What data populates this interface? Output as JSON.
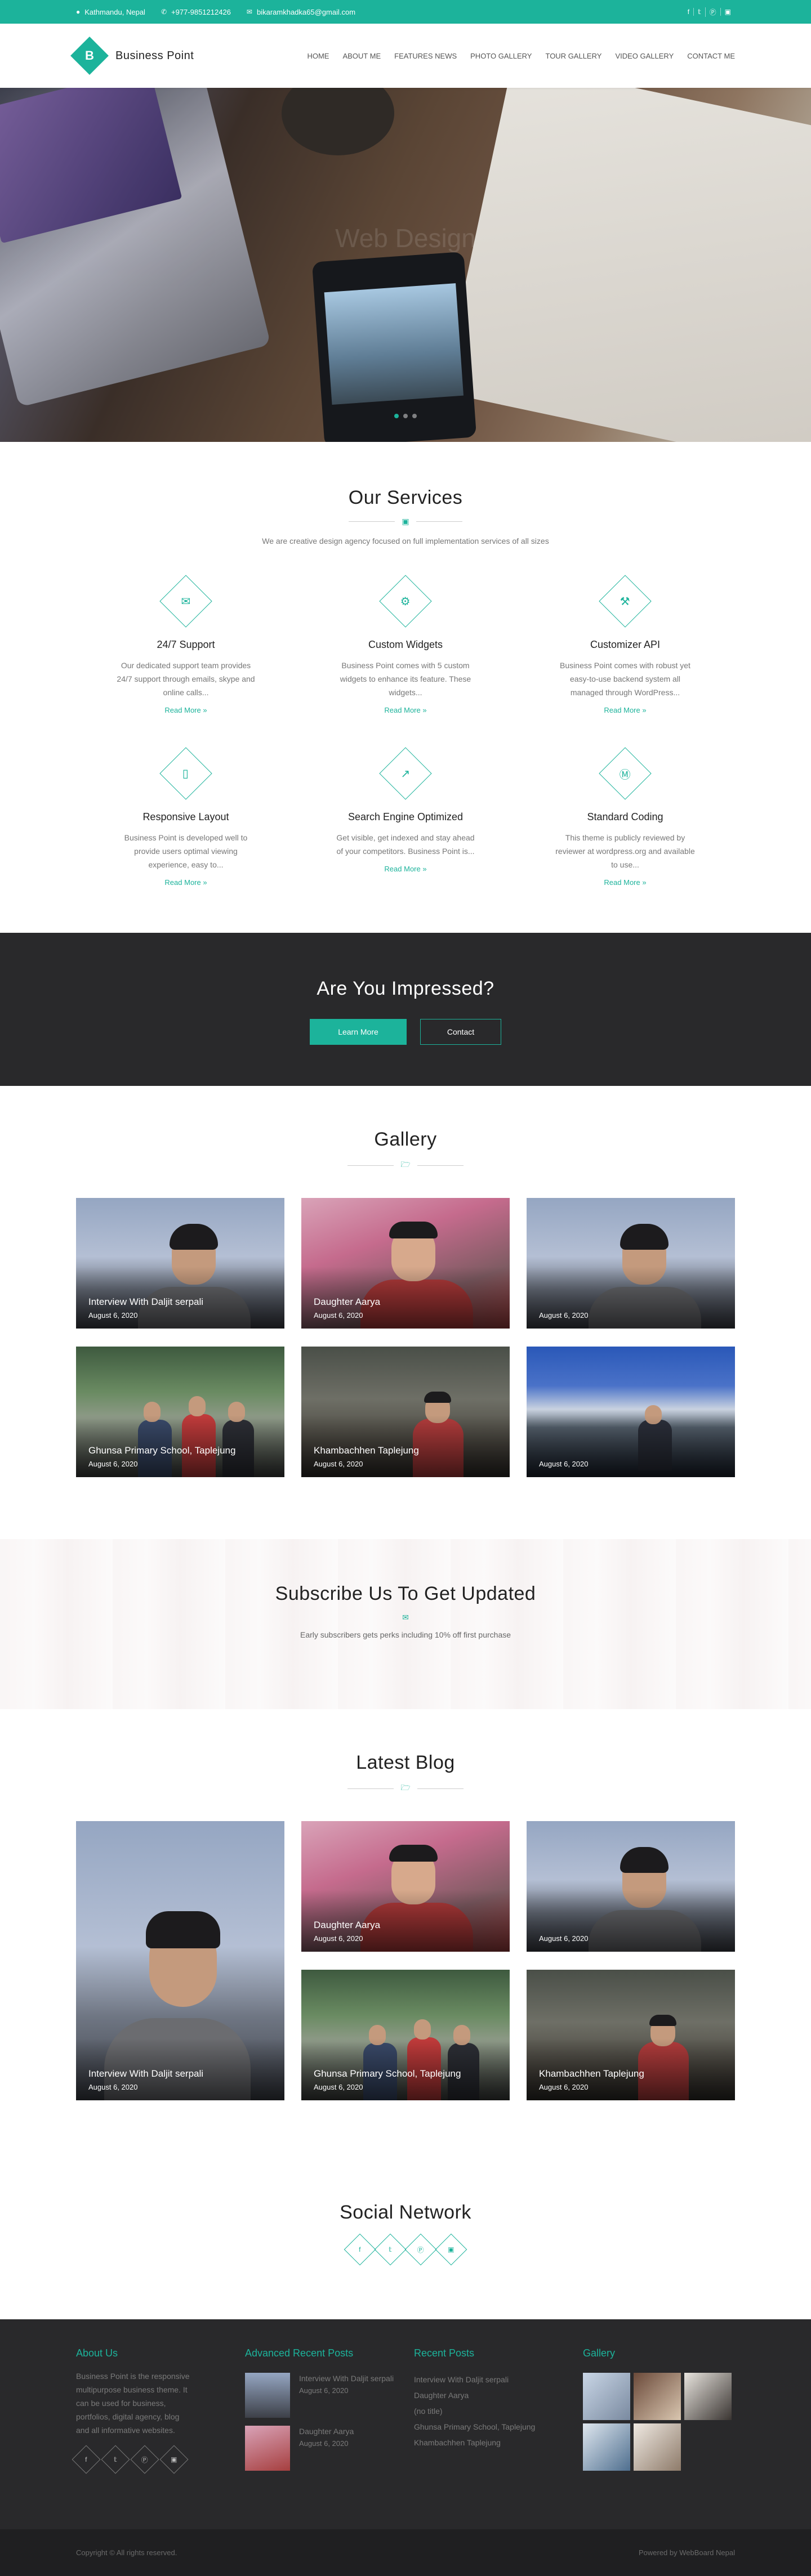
{
  "topbar": {
    "location": "Kathmandu, Nepal",
    "phone": "+977-9851212426",
    "email": "bikaramkhadka65@gmail.com",
    "socials": [
      "facebook-icon",
      "twitter-icon",
      "pinterest-icon",
      "instagram-icon"
    ]
  },
  "header": {
    "logo_letter": "B",
    "site_name": "Business Point",
    "nav": [
      "HOME",
      "ABOUT ME",
      "FEATURES NEWS",
      "PHOTO GALLERY",
      "TOUR GALLERY",
      "VIDEO GALLERY",
      "CONTACT ME"
    ]
  },
  "hero": {
    "caption": "Web Design"
  },
  "services": {
    "title": "Our Services",
    "subtitle": "We are creative design agency focused on full implementation services of all sizes",
    "read_more": "Read More",
    "items": [
      {
        "icon": "chat-icon",
        "title": "24/7 Support",
        "text": "Our dedicated support team provides 24/7 support through emails, skype and online calls..."
      },
      {
        "icon": "gear-icon",
        "title": "Custom Widgets",
        "text": "Business Point comes with 5 custom widgets to enhance its feature. These widgets..."
      },
      {
        "icon": "wrench-icon",
        "title": "Customizer API",
        "text": "Business Point comes with robust yet easy-to-use backend system all managed through WordPress..."
      },
      {
        "icon": "mobile-icon",
        "title": "Responsive Layout",
        "text": "Business Point is developed well to provide users optimal viewing experience, easy to..."
      },
      {
        "icon": "chart-icon",
        "title": "Search Engine Optimized",
        "text": "Get visible, get indexed and stay ahead of your competitors. Business Point is..."
      },
      {
        "icon": "wordpress-icon",
        "title": "Standard Coding",
        "text": "This theme is publicly reviewed by reviewer at wordpress.org and available to use..."
      }
    ]
  },
  "impressed": {
    "title": "Are You Impressed?",
    "learn_more": "Learn More",
    "contact": "Contact"
  },
  "gallery": {
    "title": "Gallery",
    "items": [
      {
        "title": "Interview With Daljit serpali",
        "date": "August 6, 2020",
        "scene": "sky"
      },
      {
        "title": "Daughter Aarya",
        "date": "August 6, 2020",
        "scene": "kid"
      },
      {
        "title": "",
        "date": "August 6, 2020",
        "scene": "sky"
      },
      {
        "title": "Ghunsa Primary School, Taplejung",
        "date": "August 6, 2020",
        "scene": "school"
      },
      {
        "title": "Khambachhen Taplejung",
        "date": "August 6, 2020",
        "scene": "village"
      },
      {
        "title": "",
        "date": "August 6, 2020",
        "scene": "mount"
      }
    ]
  },
  "subscribe": {
    "title": "Subscribe Us To Get Updated",
    "subtitle": "Early subscribers gets perks including 10% off first purchase"
  },
  "blog": {
    "title": "Latest Blog",
    "featured": {
      "title": "Interview With Daljit serpali",
      "date": "August 6, 2020"
    },
    "items": [
      {
        "title": "Daughter Aarya",
        "date": "August 6, 2020"
      },
      {
        "title": "Ghunsa Primary School, Taplejung",
        "date": "August 6, 2020"
      },
      {
        "title": "",
        "date": "August 6, 2020"
      },
      {
        "title": "Khambachhen Taplejung",
        "date": "August 6, 2020"
      }
    ]
  },
  "social": {
    "title": "Social Network",
    "icons": [
      "facebook-icon",
      "twitter-icon",
      "pinterest-icon",
      "instagram-icon"
    ]
  },
  "footer": {
    "about_title": "About Us",
    "about_text": "Business Point is the responsive multipurpose business theme. It can be used for business, portfolios, digital agency, blog and all informative websites.",
    "advanced_title": "Advanced Recent Posts",
    "advanced_posts": [
      {
        "title": "Interview With Daljit serpali",
        "date": "August 6, 2020"
      },
      {
        "title": "Daughter Aarya",
        "date": "August 6, 2020"
      }
    ],
    "recent_title": "Recent Posts",
    "recent_posts": [
      "Interview With Daljit serpali",
      "Daughter Aarya",
      "(no title)",
      "Ghunsa Primary School, Taplejung",
      "Khambachhen Taplejung"
    ],
    "gallery_title": "Gallery",
    "copyright": "Copyright © All rights reserved.",
    "powered": "Powered by WebBoard Nepal"
  },
  "colors": {
    "accent": "#1cb39b",
    "dark": "#29292b"
  }
}
